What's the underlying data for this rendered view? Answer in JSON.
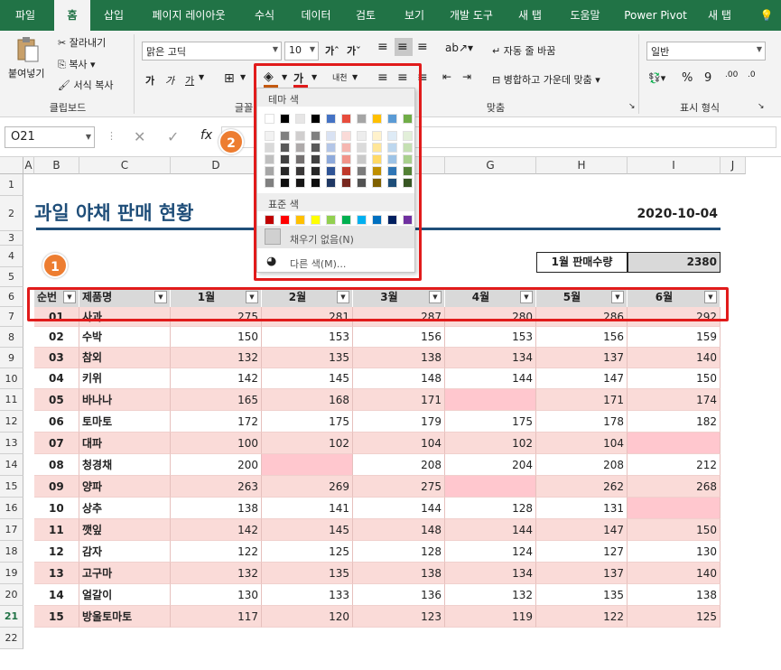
{
  "tabs": [
    "파일",
    "홈",
    "삽입",
    "페이지 레이아웃",
    "수식",
    "데이터",
    "검토",
    "보기",
    "개발 도구",
    "새 탭",
    "도움말",
    "Power Pivot",
    "새 탭"
  ],
  "ribbon": {
    "paste": "붙여넣기",
    "cut": "잘라내기",
    "copy": "복사",
    "format_painter": "서식 복사",
    "clipboard": "클립보드",
    "font_name": "맑은 고딕",
    "font_size": "10",
    "font_group": "글꼴",
    "wrap": "자동 줄 바꿈",
    "merge": "병합하고 가운데 맞춤",
    "align_group": "맞춤",
    "number_format": "일반",
    "number_group": "표시 형식",
    "bold": "가",
    "italic": "가",
    "underline": "가",
    "font_color": "가",
    "phonetic": "내천"
  },
  "formula": {
    "namebox": "O21",
    "fx": "fx"
  },
  "popup": {
    "theme_label": "테마 색",
    "standard_label": "표준 색",
    "no_fill": "채우기 없음(N)",
    "more_colors": "다른 색(M)...",
    "theme_top": [
      "#ffffff",
      "#000000",
      "#e7e6e6",
      "#000000",
      "#4472c4",
      "#e74c3c",
      "#a5a5a5",
      "#ffc000",
      "#5b9bd5",
      "#70ad47",
      "#ed7d31",
      "#4bacc6"
    ],
    "theme_cols": [
      [
        "#f2f2f2",
        "#d9d9d9",
        "#bfbfbf",
        "#a6a6a6",
        "#808080"
      ],
      [
        "#808080",
        "#595959",
        "#404040",
        "#262626",
        "#0d0d0d"
      ],
      [
        "#d0cece",
        "#aeaaaa",
        "#757171",
        "#3a3838",
        "#171616"
      ],
      [
        "#808080",
        "#595959",
        "#404040",
        "#262626",
        "#0d0d0d"
      ],
      [
        "#d9e2f3",
        "#b4c6e7",
        "#8eaadb",
        "#2f5496",
        "#1f3864"
      ],
      [
        "#fadbd8",
        "#f5b7b1",
        "#f1948a",
        "#c0392b",
        "#78281f"
      ],
      [
        "#ededed",
        "#dbdbdb",
        "#c9c9c9",
        "#7b7b7b",
        "#525252"
      ],
      [
        "#fff2cc",
        "#ffe699",
        "#ffd966",
        "#bf8f00",
        "#7f6000"
      ],
      [
        "#deebf6",
        "#bdd7ee",
        "#9dc3e6",
        "#2e75b5",
        "#1e4e79"
      ],
      [
        "#e2efd9",
        "#c5e0b3",
        "#a8d08d",
        "#538135",
        "#375623"
      ],
      [
        "#fbe5d5",
        "#f7cbac",
        "#f4b183",
        "#c55a11",
        "#833c0b"
      ],
      [
        "#daeef3",
        "#b7dde8",
        "#92cddc",
        "#31849b",
        "#205867"
      ]
    ],
    "standard": [
      "#c00000",
      "#ff0000",
      "#ffc000",
      "#ffff00",
      "#92d050",
      "#00b050",
      "#00b0f0",
      "#0070c0",
      "#002060",
      "#7030a0"
    ]
  },
  "sheet": {
    "columns": [
      "A",
      "B",
      "C",
      "D",
      "E",
      "F",
      "G",
      "H",
      "I",
      "J"
    ],
    "title": "과일 야채 판매 현황",
    "date": "2020-10-04",
    "jan_label": "1월 판매수량",
    "jan_value": "2380",
    "headers": [
      "순번",
      "제품명",
      "1월",
      "2월",
      "3월",
      "4월",
      "5월",
      "6월"
    ],
    "rows": [
      [
        "01",
        "사과",
        "275",
        "281",
        "287",
        "280",
        "286",
        "292"
      ],
      [
        "02",
        "수박",
        "150",
        "153",
        "156",
        "153",
        "156",
        "159"
      ],
      [
        "03",
        "참외",
        "132",
        "135",
        "138",
        "134",
        "137",
        "140"
      ],
      [
        "04",
        "키위",
        "142",
        "145",
        "148",
        "144",
        "147",
        "150"
      ],
      [
        "05",
        "바나나",
        "165",
        "168",
        "171",
        "",
        "171",
        "174"
      ],
      [
        "06",
        "토마토",
        "172",
        "175",
        "179",
        "175",
        "178",
        "182"
      ],
      [
        "07",
        "대파",
        "100",
        "102",
        "104",
        "102",
        "104",
        ""
      ],
      [
        "08",
        "청경채",
        "200",
        "",
        "208",
        "204",
        "208",
        "212"
      ],
      [
        "09",
        "양파",
        "263",
        "269",
        "275",
        "",
        "262",
        "268"
      ],
      [
        "10",
        "상추",
        "138",
        "141",
        "144",
        "128",
        "131",
        ""
      ],
      [
        "11",
        "깻잎",
        "142",
        "145",
        "148",
        "144",
        "147",
        "150"
      ],
      [
        "12",
        "감자",
        "122",
        "125",
        "128",
        "124",
        "127",
        "130"
      ],
      [
        "13",
        "고구마",
        "132",
        "135",
        "138",
        "134",
        "137",
        "140"
      ],
      [
        "14",
        "얼갈이",
        "130",
        "133",
        "136",
        "132",
        "135",
        "138"
      ],
      [
        "15",
        "방울토마토",
        "117",
        "120",
        "123",
        "119",
        "122",
        "125"
      ]
    ]
  },
  "badges": [
    "1",
    "2"
  ]
}
